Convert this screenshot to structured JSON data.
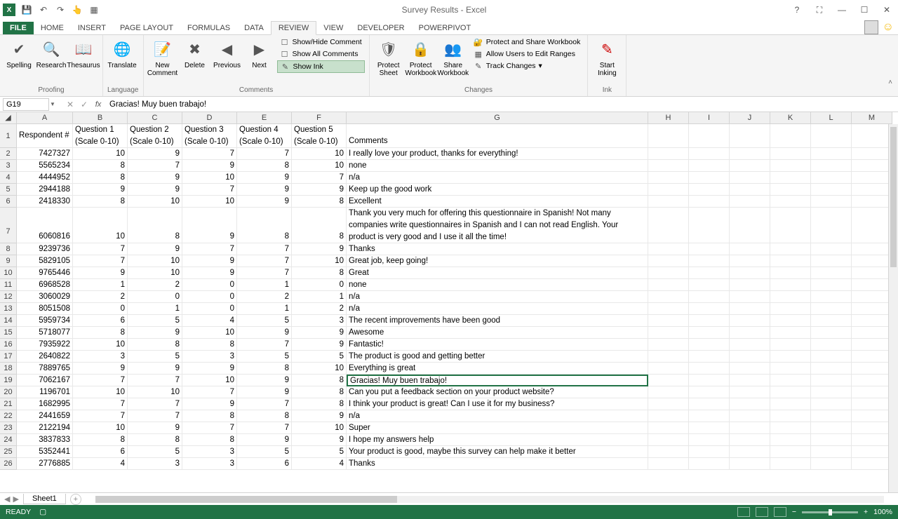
{
  "title": "Survey Results - Excel",
  "tabs": [
    "FILE",
    "HOME",
    "INSERT",
    "PAGE LAYOUT",
    "FORMULAS",
    "DATA",
    "REVIEW",
    "VIEW",
    "DEVELOPER",
    "POWERPIVOT"
  ],
  "active_tab": "REVIEW",
  "ribbon": {
    "proofing": {
      "label": "Proofing",
      "spelling": "Spelling",
      "research": "Research",
      "thesaurus": "Thesaurus"
    },
    "language": {
      "label": "Language",
      "translate": "Translate"
    },
    "comments": {
      "label": "Comments",
      "new": "New Comment",
      "delete": "Delete",
      "previous": "Previous",
      "next": "Next",
      "showhide": "Show/Hide Comment",
      "showall": "Show All Comments",
      "showink": "Show Ink"
    },
    "changes": {
      "label": "Changes",
      "protect_sheet": "Protect Sheet",
      "protect_wb": "Protect Workbook",
      "share_wb": "Share Workbook",
      "protect_share": "Protect and Share Workbook",
      "allow_ranges": "Allow Users to Edit Ranges",
      "track_changes": "Track Changes"
    },
    "ink": {
      "label": "Ink",
      "start": "Start Inking"
    }
  },
  "name_box": "G19",
  "formula": "Gracias! Muy buen trabajo!",
  "columns": [
    "A",
    "B",
    "C",
    "D",
    "E",
    "F",
    "G",
    "H",
    "I",
    "J",
    "K",
    "L",
    "M"
  ],
  "headers": {
    "A": "Respondent #",
    "B1": "Question 1",
    "B2": "(Scale 0-10)",
    "C1": "Question 2",
    "C2": "(Scale 0-10)",
    "D1": "Question 3",
    "D2": "(Scale 0-10)",
    "E1": "Question 4",
    "E2": "(Scale 0-10)",
    "F1": "Question 5",
    "F2": "(Scale 0-10)",
    "G": "Comments"
  },
  "rows": [
    {
      "n": 2,
      "a": 7427327,
      "b": 10,
      "c": 9,
      "d": 7,
      "e": 7,
      "f": 10,
      "g": "I really love your product, thanks for everything!"
    },
    {
      "n": 3,
      "a": 5565234,
      "b": 8,
      "c": 7,
      "d": 9,
      "e": 8,
      "f": 10,
      "g": "none"
    },
    {
      "n": 4,
      "a": 4444952,
      "b": 8,
      "c": 9,
      "d": 10,
      "e": 9,
      "f": 7,
      "g": "n/a"
    },
    {
      "n": 5,
      "a": 2944188,
      "b": 9,
      "c": 9,
      "d": 7,
      "e": 9,
      "f": 9,
      "g": "Keep up the good work"
    },
    {
      "n": 6,
      "a": 2418330,
      "b": 8,
      "c": 10,
      "d": 10,
      "e": 9,
      "f": 8,
      "g": "Excellent"
    },
    {
      "n": 7,
      "a": 6060816,
      "b": 10,
      "c": 8,
      "d": 9,
      "e": 8,
      "f": 8,
      "g": "Thank you very much for offering this questionnaire in Spanish! Not many companies write questionnaires in Spanish and I can not read English. Your product is very good and I use it all the time!",
      "tall": true
    },
    {
      "n": 8,
      "a": 9239736,
      "b": 7,
      "c": 9,
      "d": 7,
      "e": 7,
      "f": 9,
      "g": "Thanks"
    },
    {
      "n": 9,
      "a": 5829105,
      "b": 7,
      "c": 10,
      "d": 9,
      "e": 7,
      "f": 10,
      "g": "Great job, keep going!"
    },
    {
      "n": 10,
      "a": 9765446,
      "b": 9,
      "c": 10,
      "d": 9,
      "e": 7,
      "f": 8,
      "g": "Great"
    },
    {
      "n": 11,
      "a": 6968528,
      "b": 1,
      "c": 2,
      "d": 0,
      "e": 1,
      "f": 0,
      "g": "none"
    },
    {
      "n": 12,
      "a": 3060029,
      "b": 2,
      "c": 0,
      "d": 0,
      "e": 2,
      "f": 1,
      "g": "n/a"
    },
    {
      "n": 13,
      "a": 8051508,
      "b": 0,
      "c": 1,
      "d": 0,
      "e": 1,
      "f": 2,
      "g": "n/a"
    },
    {
      "n": 14,
      "a": 5959734,
      "b": 6,
      "c": 5,
      "d": 4,
      "e": 5,
      "f": 3,
      "g": "The recent improvements have been good"
    },
    {
      "n": 15,
      "a": 5718077,
      "b": 8,
      "c": 9,
      "d": 10,
      "e": 9,
      "f": 9,
      "g": "Awesome"
    },
    {
      "n": 16,
      "a": 7935922,
      "b": 10,
      "c": 8,
      "d": 8,
      "e": 7,
      "f": 9,
      "g": "Fantastic!"
    },
    {
      "n": 17,
      "a": 2640822,
      "b": 3,
      "c": 5,
      "d": 3,
      "e": 5,
      "f": 5,
      "g": "The product is good and getting better"
    },
    {
      "n": 18,
      "a": 7889765,
      "b": 9,
      "c": 9,
      "d": 9,
      "e": 8,
      "f": 10,
      "g": "Everything is great"
    },
    {
      "n": 19,
      "a": 7062167,
      "b": 7,
      "c": 7,
      "d": 10,
      "e": 9,
      "f": 8,
      "g": "Gracias! Muy buen trabajo!",
      "selected": true
    },
    {
      "n": 20,
      "a": 1196701,
      "b": 10,
      "c": 10,
      "d": 7,
      "e": 9,
      "f": 8,
      "g": "Can you put a feedback section on your product website?"
    },
    {
      "n": 21,
      "a": 1682995,
      "b": 7,
      "c": 7,
      "d": 9,
      "e": 7,
      "f": 8,
      "g": "I think your product is great! Can I use it for my business?"
    },
    {
      "n": 22,
      "a": 2441659,
      "b": 7,
      "c": 7,
      "d": 8,
      "e": 8,
      "f": 9,
      "g": "n/a"
    },
    {
      "n": 23,
      "a": 2122194,
      "b": 10,
      "c": 9,
      "d": 7,
      "e": 7,
      "f": 10,
      "g": "Super"
    },
    {
      "n": 24,
      "a": 3837833,
      "b": 8,
      "c": 8,
      "d": 8,
      "e": 9,
      "f": 9,
      "g": "I hope my answers help"
    },
    {
      "n": 25,
      "a": 5352441,
      "b": 6,
      "c": 5,
      "d": 3,
      "e": 5,
      "f": 5,
      "g": "Your product is good, maybe this survey can help make it better"
    },
    {
      "n": 26,
      "a": 2776885,
      "b": 4,
      "c": 3,
      "d": 3,
      "e": 6,
      "f": 4,
      "g": "Thanks"
    }
  ],
  "sheet_tab": "Sheet1",
  "status": "READY",
  "zoom": "100%"
}
